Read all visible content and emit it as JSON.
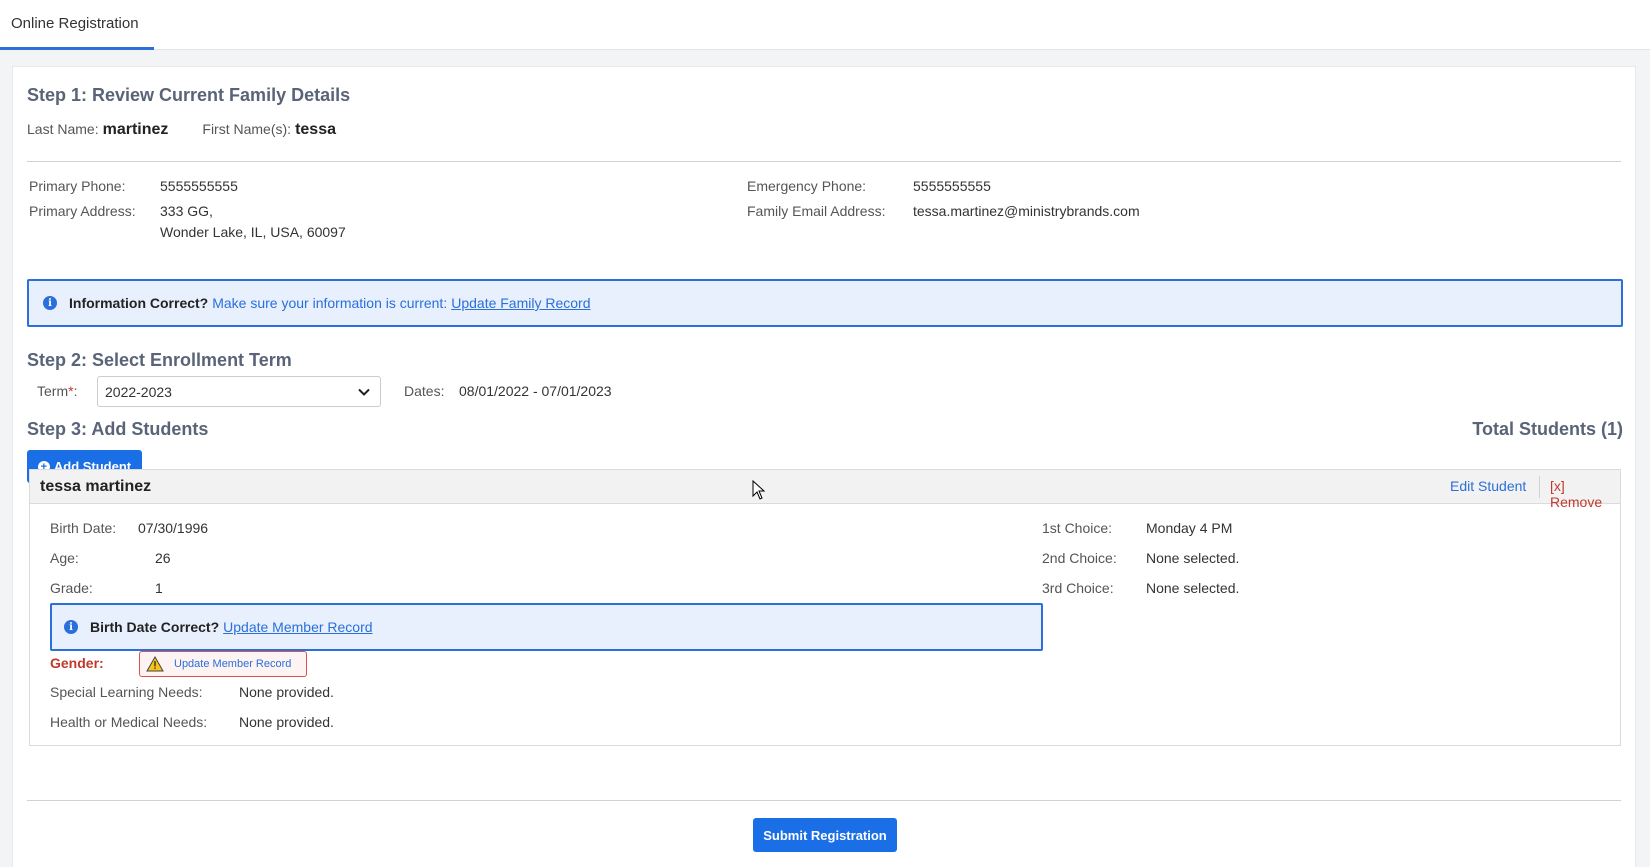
{
  "tabs": {
    "active": "Online Registration"
  },
  "step1": {
    "title": "Step 1: Review Current Family Details",
    "last_name_label": "Last Name:",
    "last_name": "martinez",
    "first_name_label": "First Name(s):",
    "first_name": "tessa",
    "primary_phone_label": "Primary Phone:",
    "primary_phone": "5555555555",
    "primary_address_label": "Primary Address:",
    "address_line1": "333 GG,",
    "address_line2": "Wonder Lake, IL, USA, 60097",
    "emergency_phone_label": "Emergency Phone:",
    "emergency_phone": "5555555555",
    "email_label": "Family Email Address:",
    "email": "tessa.martinez@ministrybrands.com",
    "info_bold": "Information Correct?",
    "info_text": "Make sure your information is current:",
    "info_link": "Update Family Record"
  },
  "step2": {
    "title": "Step 2: Select Enrollment Term",
    "term_label": "Term",
    "required_mark": "*",
    "term_colon": ":",
    "term_value": "2022-2023",
    "dates_label": "Dates:",
    "dates_value": "08/01/2022 - 07/01/2023"
  },
  "step3": {
    "title": "Step 3: Add Students",
    "total": "Total Students (1)",
    "add_button": "Add Student"
  },
  "student": {
    "name": "tessa martinez",
    "edit": "Edit Student",
    "remove": "[x] Remove",
    "birth_label": "Birth Date:",
    "birth": "07/30/1996",
    "age_label": "Age:",
    "age": "26",
    "grade_label": "Grade:",
    "grade": "1",
    "choice1_label": "1st Choice:",
    "choice1": "Monday 4 PM",
    "choice2_label": "2nd Choice:",
    "choice2": "None selected.",
    "choice3_label": "3rd Choice:",
    "choice3": "None selected.",
    "birth_info_bold": "Birth Date Correct?",
    "birth_info_link": "Update Member Record",
    "gender_label": "Gender:",
    "gender_button": "Update Member Record",
    "sln_label": "Special Learning Needs:",
    "sln": "None provided.",
    "health_label": "Health or Medical Needs:",
    "health": "None provided."
  },
  "footer": {
    "submit": "Submit Registration"
  },
  "colors": {
    "accent": "#2a6fdb",
    "button": "#1a6fe6",
    "error": "#c0392b"
  },
  "icons": [
    "info-icon",
    "chevron-down-icon",
    "plus-circle-icon",
    "warning-icon",
    "mouse-cursor-icon"
  ]
}
